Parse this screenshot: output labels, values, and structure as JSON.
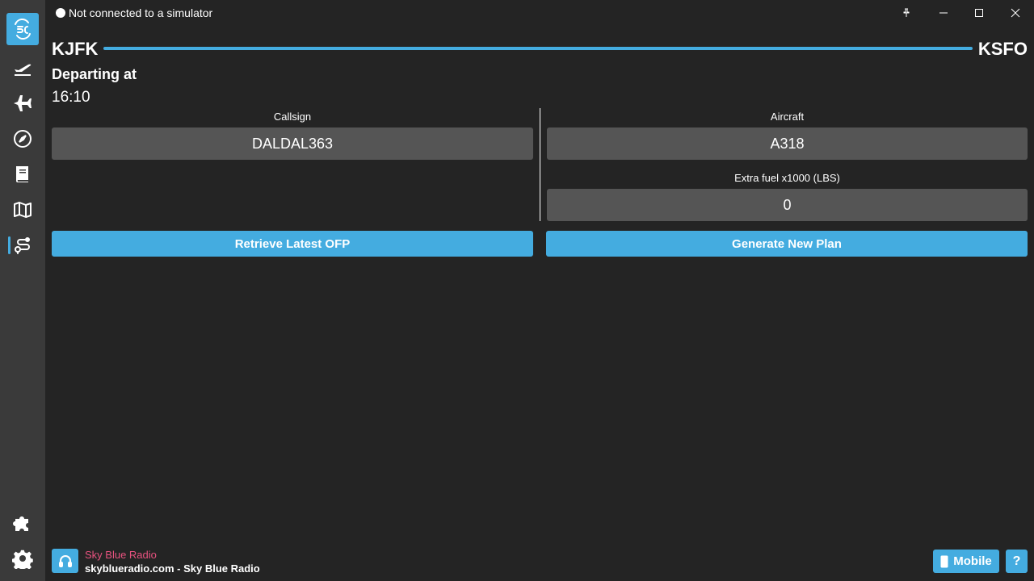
{
  "titlebar": {
    "connection_status": "Not connected to a simulator"
  },
  "sidebar": {
    "items": [
      {
        "name": "simbrief-logo-icon",
        "active": true
      },
      {
        "name": "departure-icon"
      },
      {
        "name": "plane-icon"
      },
      {
        "name": "compass-icon"
      },
      {
        "name": "book-icon"
      },
      {
        "name": "map-icon"
      },
      {
        "name": "route-icon"
      }
    ],
    "bottom": [
      {
        "name": "puzzle-icon"
      },
      {
        "name": "gear-icon"
      }
    ]
  },
  "route": {
    "origin": "KJFK",
    "destination": "KSFO"
  },
  "departure": {
    "label": "Departing at",
    "time": "16:10"
  },
  "form": {
    "callsign_label": "Callsign",
    "callsign_value": "DALDAL363",
    "aircraft_label": "Aircraft",
    "aircraft_value": "A318",
    "extra_fuel_label": "Extra fuel x1000 (LBS)",
    "extra_fuel_value": "0"
  },
  "actions": {
    "retrieve_label": "Retrieve Latest OFP",
    "generate_label": "Generate New Plan"
  },
  "footer": {
    "radio_name": "Sky Blue Radio",
    "radio_desc": "skyblueradio.com - Sky Blue Radio",
    "mobile_label": "Mobile",
    "help_label": "?"
  },
  "colors": {
    "accent": "#44ace0",
    "background": "#242424",
    "sidebar": "#3a3a3a",
    "field": "#555555",
    "radio_name": "#e8527f"
  }
}
